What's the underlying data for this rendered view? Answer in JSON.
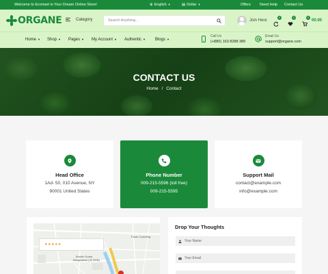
{
  "topbar": {
    "welcome": "Welcome to Ecomart in Your Dream Online Store!",
    "language": "English",
    "currency": "Dollar",
    "links": [
      "Offers",
      "Need Help",
      "Contact Us"
    ]
  },
  "header": {
    "logo_text": "ORGANE",
    "category_label": "Category",
    "search_placeholder": "Search Anything...",
    "join_label": "Join Here",
    "compare_count": "0",
    "wishlist_count": "0",
    "cart_count": "0",
    "cart_total": "00.00"
  },
  "nav": {
    "items": [
      "Home",
      "Shop",
      "Pages",
      "My Account",
      "Authentic",
      "Blogs"
    ],
    "call_label": "Call Us",
    "call_value": "(+880) 163 8288 389",
    "email_label": "Email Us",
    "email_value": "support@organe.com"
  },
  "hero": {
    "title": "CONTACT US",
    "breadcrumb_home": "Home",
    "breadcrumb_sep": "/",
    "breadcrumb_current": "Contact"
  },
  "cards": {
    "office": {
      "title": "Head Office",
      "line1": "1Ad- 50, 010 Avenue, NY",
      "line2": "90001 United States"
    },
    "phone": {
      "title": "Phone Number",
      "line1": "009-215-5596 (toll free)",
      "line2": "009-215-5595"
    },
    "mail": {
      "title": "Support Mail",
      "line1": "contact@example.com",
      "line2": "info@example.com"
    }
  },
  "map": {
    "stars": "★★★★★",
    "labels": [
      "Faruk Coaching",
      "Border Guard",
      "Bangladesh (42 BGB)"
    ]
  },
  "form": {
    "title": "Drop Your Thoughts",
    "name_placeholder": "Your Name",
    "email_placeholder": "Your Email"
  },
  "colors": {
    "brand_green": "#1a8a3a",
    "header_bg": "#d9f5c8"
  }
}
